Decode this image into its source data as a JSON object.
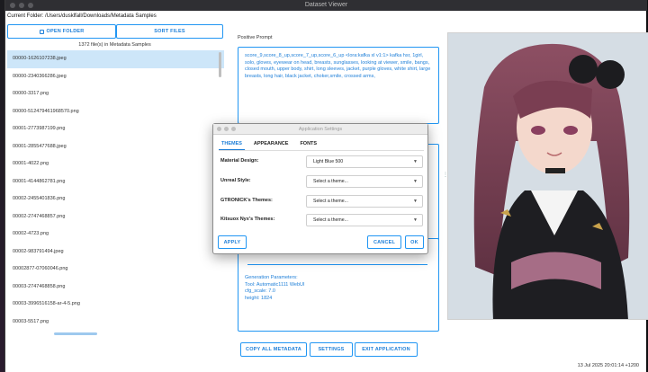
{
  "window": {
    "title": "Dataset Viewer"
  },
  "folder": {
    "label": "Current Folder: /Users/dusklfall/Downloads/Metadata Samples"
  },
  "buttons": {
    "open_folder": "OPEN FOLDER",
    "sort_files": "SORT FILES",
    "copy_all": "COPY ALL METADATA",
    "settings": "SETTINGS",
    "exit": "EXIT APPLICATION"
  },
  "list": {
    "count_label": "1372 file(s) in Metadata Samples",
    "files": [
      "00000-1626107238.jpeg",
      "00000-2340366286.jpeg",
      "00000-3317.png",
      "00000-512479461968570.png",
      "00001-2773987199.png",
      "00001-2855477688.jpeg",
      "00001-4022.png",
      "00001-4144862781.png",
      "00002-2455401836.png",
      "00002-2747468857.png",
      "00002-4723.png",
      "00002-983791494.jpeg",
      "00002877-07060046.png",
      "00003-2747468858.png",
      "00003-3996516158-ar-4-5.png",
      "00003-5517.png"
    ],
    "selected_index": 0
  },
  "prompt": {
    "label": "Positive Prompt",
    "text": "score_9,score_8_up,score_7_up,score_6_up <lora:kafka xl v1:1> kafka hsr, 1girl, solo, gloves, eyewear on head, breasts, sunglasses, looking at viewer, smile, bangs, closed mouth, upper body, shirt, long sleeves, jacket, purple gloves, white shirt, large breasts, long hair, black jacket, choker,smile, crossed arms,"
  },
  "generation": {
    "heading": "Generation Parameters:",
    "lines": [
      "Tool: Automatic1111 WebUI",
      "cfg_scale: 7.0",
      "height: 1824"
    ]
  },
  "status": {
    "timestamp": "13 Jul 2025 20:01:14 +1200"
  },
  "dialog": {
    "title": "Application Settings",
    "tabs": [
      "THEMES",
      "APPEARANCE",
      "FONTS"
    ],
    "active_tab": 0,
    "rows": [
      {
        "label": "Material Design:",
        "value": "Light Blue 500"
      },
      {
        "label": "Unreal Style:",
        "value": "Select a theme..."
      },
      {
        "label": "GTRONICK's Themes:",
        "value": "Select a theme..."
      },
      {
        "label": "Kitsuox Nyx's Themes:",
        "value": "Select a theme..."
      }
    ],
    "apply": "APPLY",
    "cancel": "CANCEL",
    "ok": "OK"
  },
  "colors": {
    "accent": "#2196f3",
    "selection": "#cde6f9"
  }
}
